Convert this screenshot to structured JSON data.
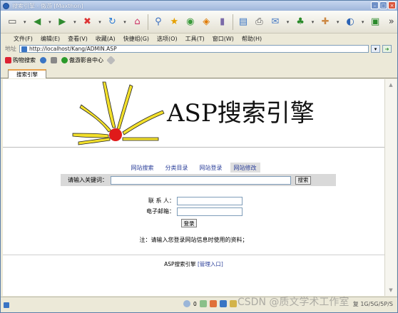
{
  "window": {
    "title": "搜索引擎 - 傲游 [Maxthon]"
  },
  "menu": [
    "文件(F)",
    "编辑(E)",
    "查看(V)",
    "收藏(A)",
    "快捷组(G)",
    "选项(O)",
    "工具(T)",
    "窗口(W)",
    "帮助(H)"
  ],
  "address": {
    "label": "地址",
    "url": "http://localhost/Kang/ADMIN.ASP"
  },
  "links": [
    {
      "label": "购物搜索",
      "icon": "shopping-icon"
    },
    {
      "label": "",
      "icon": "edit-icon"
    },
    {
      "label": "",
      "icon": "tools-icon"
    },
    {
      "label": "傲游影音中心",
      "icon": "media-icon"
    },
    {
      "label": "",
      "icon": "favorite-icon"
    }
  ],
  "tab": {
    "label": "搜索引擎"
  },
  "page": {
    "site_title": "ASP搜索引擎",
    "nav": [
      "网站搜索",
      "分类目录",
      "网站登录",
      "网站修改"
    ],
    "active_nav": 3,
    "search": {
      "label": "请输入关键词：",
      "button": "搜索"
    },
    "form": {
      "contact_label": "联 系 人：",
      "email_label": "电子邮箱：",
      "login_button": "登录"
    },
    "note": "注：请输入您登录网站信息时使用的资料；",
    "footer": {
      "text": "ASP搜索引擎",
      "admin_link": "[管理入口]"
    }
  },
  "status": {
    "count": "0",
    "right_text": "复 1G/5G/5P/S"
  },
  "watermark": "CSDN @质文学术工作室",
  "colors": {
    "accent": "#e8a04a",
    "link": "#2b3f9a",
    "logo_yellow": "#f3e02b",
    "logo_red": "#e01a1a"
  }
}
